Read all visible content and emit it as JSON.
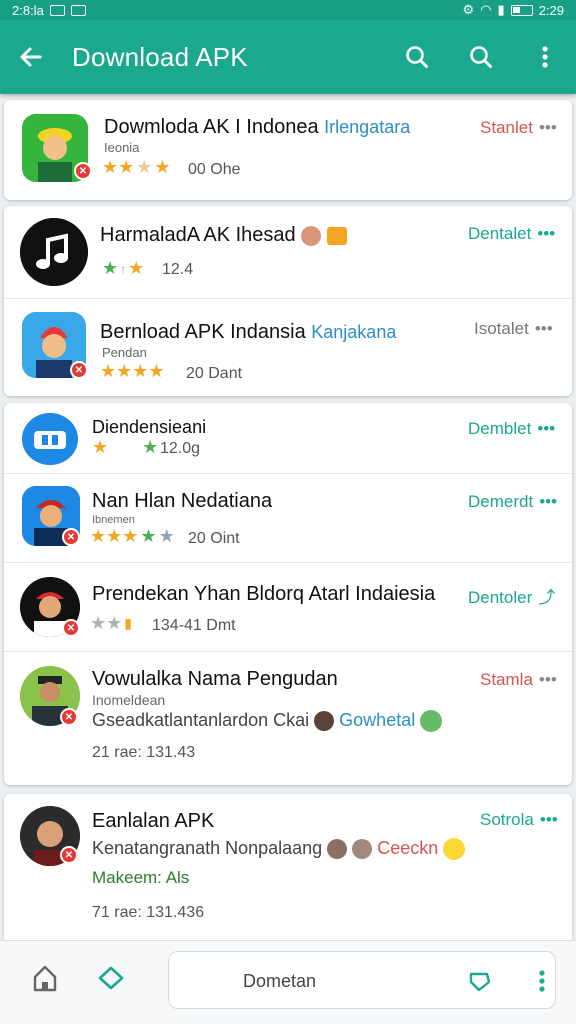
{
  "status_bar": {
    "left_time": "2:8:la",
    "right_time": "2:29"
  },
  "app_bar": {
    "title": "Download APK"
  },
  "colors": {
    "accent": "#1aa88f",
    "install_red": "#d9534f",
    "install_teal": "#1aa88f",
    "tag_blue": "#2b8fc7"
  },
  "items": [
    {
      "name": "Dowmloda AK I Indonea",
      "tag": "Irlengatara",
      "sub": "Ieonia",
      "rating": 3,
      "meta": "00 Ohe",
      "action": "Stanlet",
      "action_color": "red"
    },
    {
      "name": "HarmaladA AK Ihesad",
      "tag": "",
      "sub": "",
      "rating": 2,
      "meta": "12.4",
      "action": "Dentalet",
      "action_color": "teal"
    },
    {
      "name": "Bernload APK Indansia",
      "tag": "Kanjakana",
      "sub": "Pendan",
      "rating": 4,
      "meta": "20 Dant",
      "action": "Isotalet",
      "action_color": "gray"
    },
    {
      "name": "Diendensieani",
      "tag": "",
      "sub": "",
      "rating": 2,
      "meta": "12.0g",
      "action": "Demblet",
      "action_color": "teal"
    },
    {
      "name": "Nan Hlan Nedatiana",
      "tag": "",
      "sub": "Ibnemen",
      "rating": 4,
      "meta": "20 Oint",
      "action": "Demerdt",
      "action_color": "teal"
    },
    {
      "name": "Prendekan Yhan Bldorq Atarl Indaiesia",
      "tag": "",
      "sub": "",
      "rating": 2,
      "meta": "134-41 Dmt",
      "action": "Dentoler",
      "action_color": "teal"
    },
    {
      "name": "Vowulalka Nama Pengudan",
      "tag": "",
      "sub": "Inomeldean",
      "line2": "Gseadkatlantanlardon Ckai",
      "tag2": "Gowhetal",
      "meta": "21 rae: 131.43",
      "action": "Stamla",
      "action_color": "red"
    },
    {
      "name": "Eanlalan APK",
      "tag": "",
      "sub": "",
      "line2": "Kenatangranath Nonpalaang",
      "tag2": "Ceeckn",
      "line3": "Makeem: Als",
      "meta": "71 rae: 131.436",
      "action": "Sotrola",
      "action_color": "teal"
    }
  ],
  "bottom_bar": {
    "field_text": "Dometan"
  }
}
